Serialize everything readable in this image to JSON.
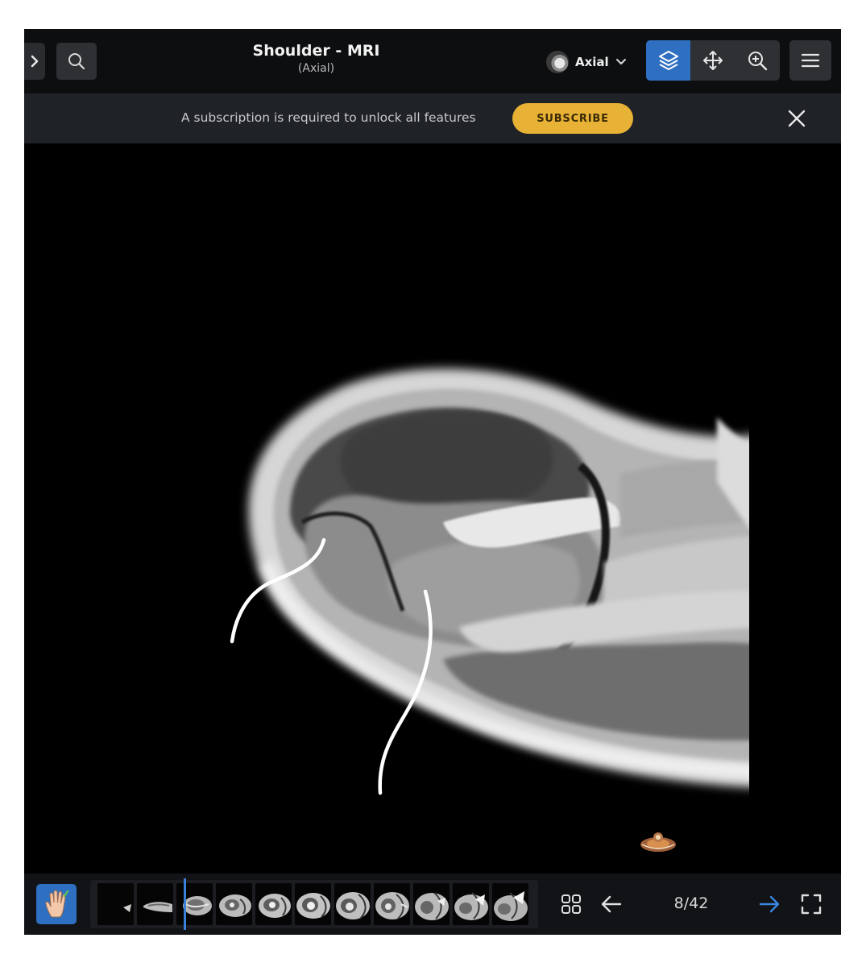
{
  "header": {
    "title": "Shoulder - MRI",
    "subtitle": "(Axial)",
    "plane_label": "Axial",
    "icons": {
      "expand": "chevron-right-icon",
      "search": "search-icon",
      "plane": "axial-thumbnail-icon",
      "dropdown": "chevron-down-icon",
      "layers": "layers-icon",
      "pan": "move-icon",
      "zoom": "zoom-in-icon",
      "menu": "hamburger-menu-icon"
    }
  },
  "banner": {
    "message": "A subscription is required to unlock all features",
    "subscribe_label": "SUBSCRIBE",
    "close_icon": "close-icon"
  },
  "viewer": {
    "image": "axial shoulder MRI slice",
    "orientation_icon": "body-orientation-icon"
  },
  "footer": {
    "hand_icon": "hand-tool-icon",
    "thumbnail_count": 11,
    "grid_icon": "grid-icon",
    "prev_icon": "arrow-left-icon",
    "counter": "8/42",
    "next_icon": "arrow-right-icon",
    "fullscreen_icon": "fullscreen-icon"
  },
  "colors": {
    "accent_blue": "#2f6fc1",
    "subscribe_yellow": "#e7b235",
    "banner_bg": "#1f2226",
    "topbar_bg": "#0d0e10"
  }
}
